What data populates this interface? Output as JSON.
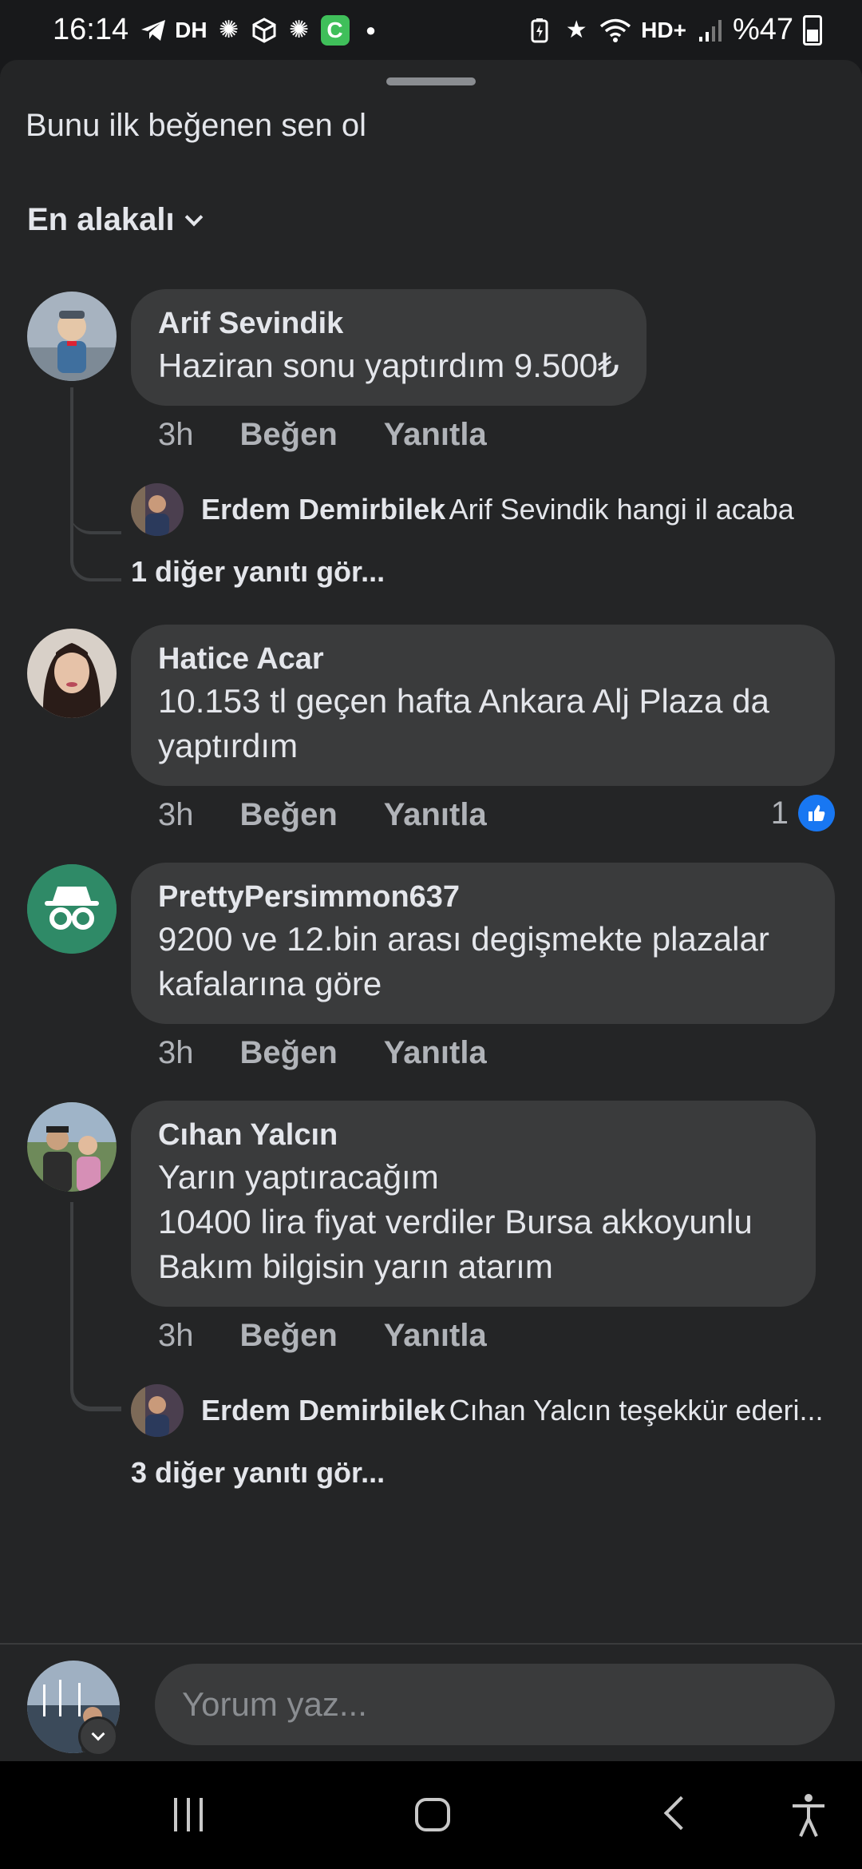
{
  "status_bar": {
    "time": "16:14",
    "dh_label": "DH",
    "hd_label": "HD+",
    "battery": "%47",
    "icons_left": [
      "telegram-icon",
      "dh-icon",
      "virus-icon",
      "box-icon",
      "virus-icon",
      "c-app-icon",
      "dot-icon"
    ],
    "icons_right": [
      "battery-saver-icon",
      "star-icon",
      "wifi-icon",
      "hd-icon",
      "signal-icon",
      "battery-icon"
    ]
  },
  "sheet": {
    "like_prompt": "Bunu ilk beğenen sen ol",
    "sort_label": "En alakalı"
  },
  "comments": [
    {
      "author": "Arif Sevindik",
      "text": "Haziran sonu yaptırdım 9.500₺",
      "time": "3h",
      "like": "Beğen",
      "reply": "Yanıtla",
      "reply_preview": {
        "author": "Erdem Demirbilek",
        "text": "Arif Sevindik hangi il acaba"
      },
      "more_replies": "1 diğer yanıtı gör..."
    },
    {
      "author": "Hatice Acar",
      "text": "10.153 tl geçen hafta Ankara Alj Plaza da\nyaptırdım",
      "time": "3h",
      "like": "Beğen",
      "reply": "Yanıtla",
      "like_count": "1"
    },
    {
      "author": "PrettyPersimmon637",
      "text": "9200 ve 12.bin arası degişmekte plazalar\nkafalarına göre",
      "time": "3h",
      "like": "Beğen",
      "reply": "Yanıtla"
    },
    {
      "author": "Cıhan Yalcın",
      "text": "Yarın yaptıracağım\n10400 lira fiyat verdiler Bursa akkoyunlu\nBakım bilgisin yarın atarım",
      "time": "3h",
      "like": "Beğen",
      "reply": "Yanıtla",
      "reply_preview": {
        "author": "Erdem Demirbilek",
        "text": "Cıhan Yalcın teşekkür ederi..."
      },
      "more_replies": "3 diğer yanıtı gör..."
    }
  ],
  "composer": {
    "placeholder": "Yorum yaz..."
  },
  "colors": {
    "background": "#18191b",
    "sheet": "#242526",
    "bubble": "#3a3b3c",
    "text": "#e4e6eb",
    "muted": "#b0b3b8",
    "like_blue": "#1877f2",
    "anon_avatar": "#2f8a67"
  }
}
